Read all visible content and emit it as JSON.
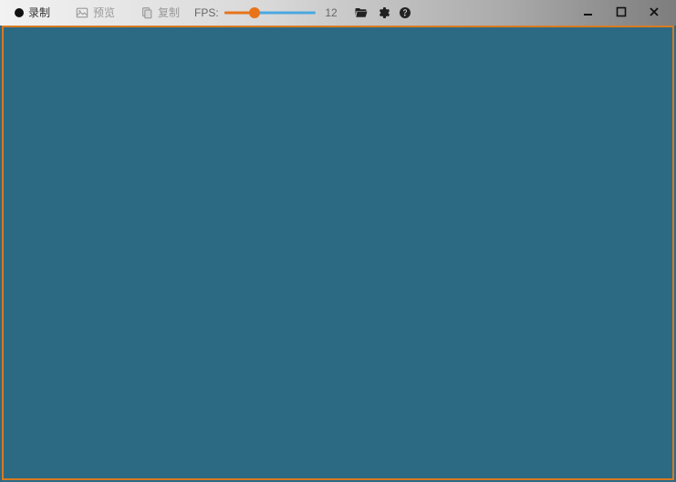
{
  "toolbar": {
    "record_label": "录制",
    "preview_label": "预览",
    "copy_label": "复制"
  },
  "fps": {
    "label": "FPS:",
    "value": "12",
    "percent": 33
  },
  "colors": {
    "accent_orange": "#e8731a",
    "canvas_bg": "#2c6a84",
    "slider_track": "#4aa8e0",
    "border_orange": "#d97a1f"
  }
}
